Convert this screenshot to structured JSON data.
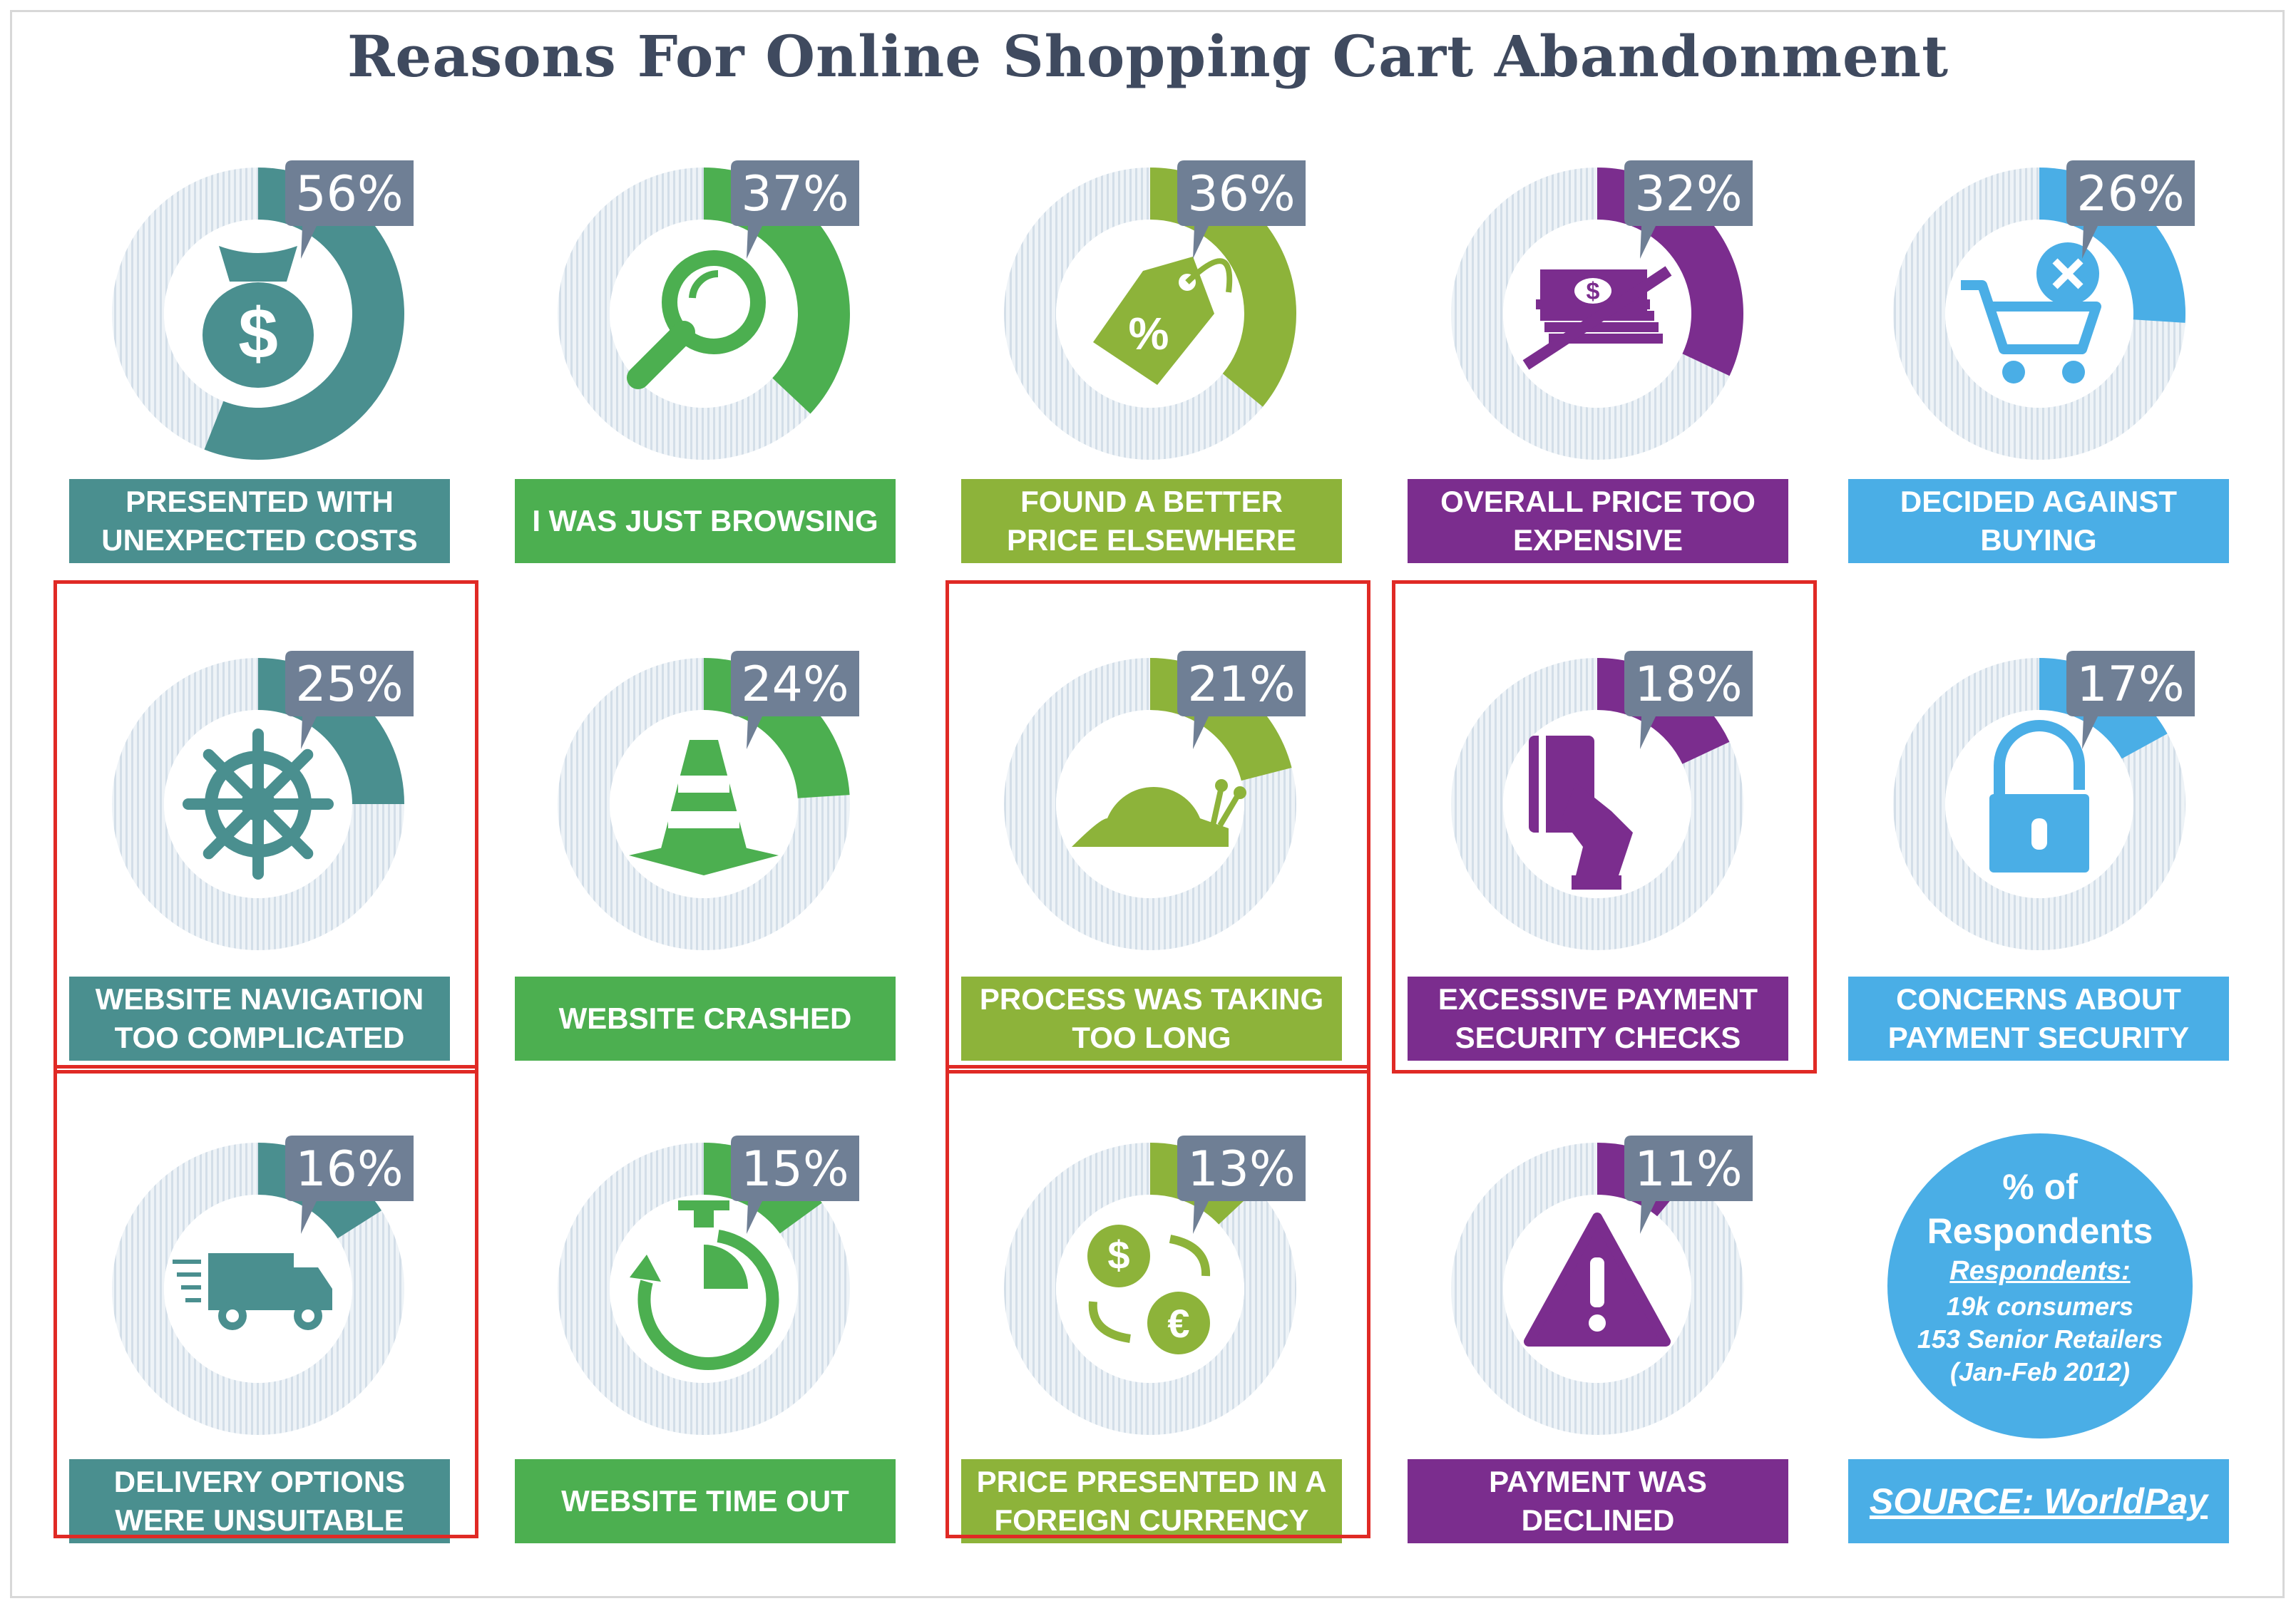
{
  "chart_data": {
    "type": "pie",
    "title": "Reasons For Online Shopping Cart Abandonment",
    "categories": [
      "PRESENTED WITH\nUNEXPECTED COSTS",
      "I WAS JUST BROWSING",
      "FOUND A BETTER\nPRICE ELSEWHERE",
      "OVERALL PRICE TOO\nEXPENSIVE",
      "DECIDED AGAINST\nBUYING",
      "WEBSITE NAVIGATION\nTOO COMPLICATED",
      "WEBSITE CRASHED",
      "PROCESS WAS TAKING\nTOO LONG",
      "EXCESSIVE PAYMENT\nSECURITY CHECKS",
      "CONCERNS ABOUT\nPAYMENT SECURITY",
      "DELIVERY OPTIONS\nWERE UNSUITABLE",
      "WEBSITE TIME OUT",
      "PRICE PRESENTED IN A\nFOREIGN CURRENCY",
      "PAYMENT WAS\nDECLINED"
    ],
    "values": [
      56,
      37,
      36,
      32,
      26,
      25,
      24,
      21,
      18,
      17,
      16,
      15,
      13,
      11
    ],
    "value_labels": [
      "56%",
      "37%",
      "36%",
      "32%",
      "26%",
      "25%",
      "24%",
      "21%",
      "18%",
      "17%",
      "16%",
      "15%",
      "13%",
      "11%"
    ],
    "icons": [
      "money-bag-icon",
      "magnifier-icon",
      "price-tag-icon",
      "cash-stack-icon",
      "cart-remove-icon",
      "ship-wheel-icon",
      "traffic-cone-icon",
      "snail-icon",
      "card-hand-icon",
      "padlock-icon",
      "delivery-van-icon",
      "stopwatch-icon",
      "currency-exchange-icon",
      "warning-icon"
    ],
    "colors": [
      "#4a8f8f",
      "#4caf50",
      "#8db33a",
      "#7b2d8e",
      "#4aaee6",
      "#4a8f8f",
      "#4caf50",
      "#8db33a",
      "#7b2d8e",
      "#4aaee6",
      "#4a8f8f",
      "#4caf50",
      "#8db33a",
      "#7b2d8e"
    ],
    "highlighted": [
      false,
      false,
      false,
      false,
      false,
      true,
      false,
      true,
      true,
      false,
      true,
      false,
      true,
      false
    ],
    "track_color": "#dde6ee",
    "badge_color": "#6f7f95",
    "highlight_color": "#e02a25"
  },
  "legend": {
    "title": "% of\nRespondents",
    "respondents_heading": "Respondents:",
    "lines": [
      "19k consumers",
      "153 Senior Retailers",
      "(Jan-Feb 2012)"
    ]
  },
  "source": "SOURCE: WorldPay"
}
